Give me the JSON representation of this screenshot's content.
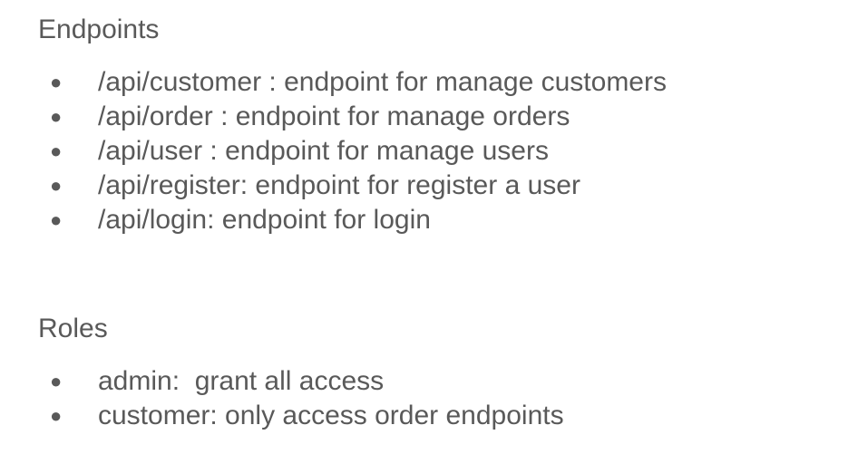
{
  "endpoints": {
    "heading": "Endpoints",
    "items": [
      "/api/customer : endpoint for manage customers",
      "/api/order : endpoint for manage orders",
      "/api/user : endpoint for manage users",
      "/api/register: endpoint for register a user",
      "/api/login: endpoint for login"
    ]
  },
  "roles": {
    "heading": "Roles",
    "items": [
      "admin:  grant all access",
      "customer: only access order endpoints"
    ]
  },
  "bullet_glyph": "●"
}
